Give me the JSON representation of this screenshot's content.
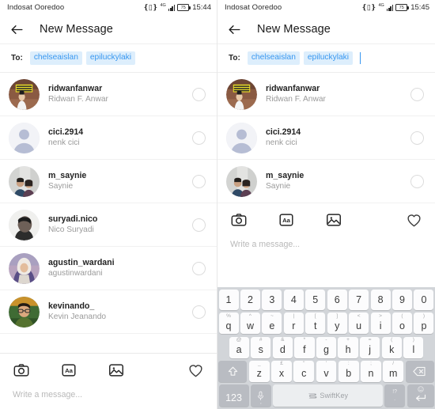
{
  "panels": [
    {
      "status": {
        "carrier": "Indosat Ooredoo",
        "network": "4G",
        "battery": "75",
        "time": "15:44"
      },
      "appbar": {
        "title": "New Message",
        "back_icon": "arrow-left-icon"
      },
      "to": {
        "label": "To:",
        "chips": [
          "chelseaislan",
          "epiluckylaki"
        ],
        "caret_visible": false
      },
      "contacts": [
        {
          "username": "ridwanfanwar",
          "fullname": "Ridwan F. Anwar",
          "avatar": "photo-poster",
          "selected": false
        },
        {
          "username": "cici.2914",
          "fullname": "nenk cici",
          "avatar": "default-person",
          "selected": false
        },
        {
          "username": "m_saynie",
          "fullname": "Saynie",
          "avatar": "photo-couple",
          "selected": false
        },
        {
          "username": "suryadi.nico",
          "fullname": "Nico Suryadi",
          "avatar": "photo-man-profile",
          "selected": false
        },
        {
          "username": "agustin_wardani",
          "fullname": "agustinwardani",
          "avatar": "photo-hijab",
          "selected": false
        },
        {
          "username": "kevinando_",
          "fullname": "Kevin Jeanando",
          "avatar": "photo-man-glasses",
          "selected": false
        }
      ],
      "composer": {
        "placeholder": "Write a message...",
        "icons": [
          "camera-icon",
          "text-aa-icon",
          "gallery-icon",
          "heart-icon"
        ],
        "aa_label": "Aa"
      },
      "keyboard_visible": false
    },
    {
      "status": {
        "carrier": "Indosat Ooredoo",
        "network": "4G",
        "battery": "75",
        "time": "15:45"
      },
      "appbar": {
        "title": "New Message",
        "back_icon": "arrow-left-icon"
      },
      "to": {
        "label": "To:",
        "chips": [
          "chelseaislan",
          "epiluckylaki"
        ],
        "caret_visible": true
      },
      "contacts": [
        {
          "username": "ridwanfanwar",
          "fullname": "Ridwan F. Anwar",
          "avatar": "photo-poster",
          "selected": false
        },
        {
          "username": "cici.2914",
          "fullname": "nenk cici",
          "avatar": "default-person",
          "selected": false
        },
        {
          "username": "m_saynie",
          "fullname": "Saynie",
          "avatar": "photo-couple",
          "selected": false
        }
      ],
      "composer": {
        "placeholder": "Write a message...",
        "icons": [
          "camera-icon",
          "text-aa-icon",
          "gallery-icon",
          "heart-icon"
        ],
        "aa_label": "Aa"
      },
      "keyboard_visible": true
    }
  ],
  "keyboard": {
    "brand": "SwiftKey",
    "rows": {
      "numbers": [
        "1",
        "2",
        "3",
        "4",
        "5",
        "6",
        "7",
        "8",
        "9",
        "0"
      ],
      "qwerty": [
        {
          "main": "q",
          "sup": "%"
        },
        {
          "main": "w",
          "sup": "^"
        },
        {
          "main": "e",
          "sup": "~"
        },
        {
          "main": "r",
          "sup": "|"
        },
        {
          "main": "t",
          "sup": "["
        },
        {
          "main": "y",
          "sup": "]"
        },
        {
          "main": "u",
          "sup": "<"
        },
        {
          "main": "i",
          "sup": ">"
        },
        {
          "main": "o",
          "sup": "("
        },
        {
          "main": "p",
          "sup": ")"
        }
      ],
      "asdf": [
        {
          "main": "a",
          "sup": "@"
        },
        {
          "main": "s",
          "sup": "#"
        },
        {
          "main": "d",
          "sup": "&"
        },
        {
          "main": "f",
          "sup": "*"
        },
        {
          "main": "g",
          "sup": "-"
        },
        {
          "main": "h",
          "sup": "+"
        },
        {
          "main": "j",
          "sup": "="
        },
        {
          "main": "k",
          "sup": "("
        },
        {
          "main": "l",
          "sup": ")"
        }
      ],
      "zxcv": [
        {
          "main": "z",
          "sup": "_"
        },
        {
          "main": "x",
          "sup": "£"
        },
        {
          "main": "c",
          "sup": "\""
        },
        {
          "main": "v",
          "sup": "'"
        },
        {
          "main": "b",
          "sup": ":"
        },
        {
          "main": "n",
          "sup": ";"
        },
        {
          "main": "m",
          "sup": "/"
        }
      ]
    },
    "keys": {
      "shift": "shift-icon",
      "backspace": "backspace-icon",
      "numeric": "123",
      "mic": "mic-icon",
      "mic_sub": ",",
      "period_main": ".",
      "period_sup": "!?",
      "enter": "enter-icon",
      "emoji": "smiley-icon"
    }
  },
  "colors": {
    "chip_bg": "#ddeefc",
    "chip_text": "#3897f0",
    "keyboard_bg": "#d2d5d9",
    "key_bg": "#fcfcfd",
    "fn_key_bg": "#b9bcc2"
  }
}
